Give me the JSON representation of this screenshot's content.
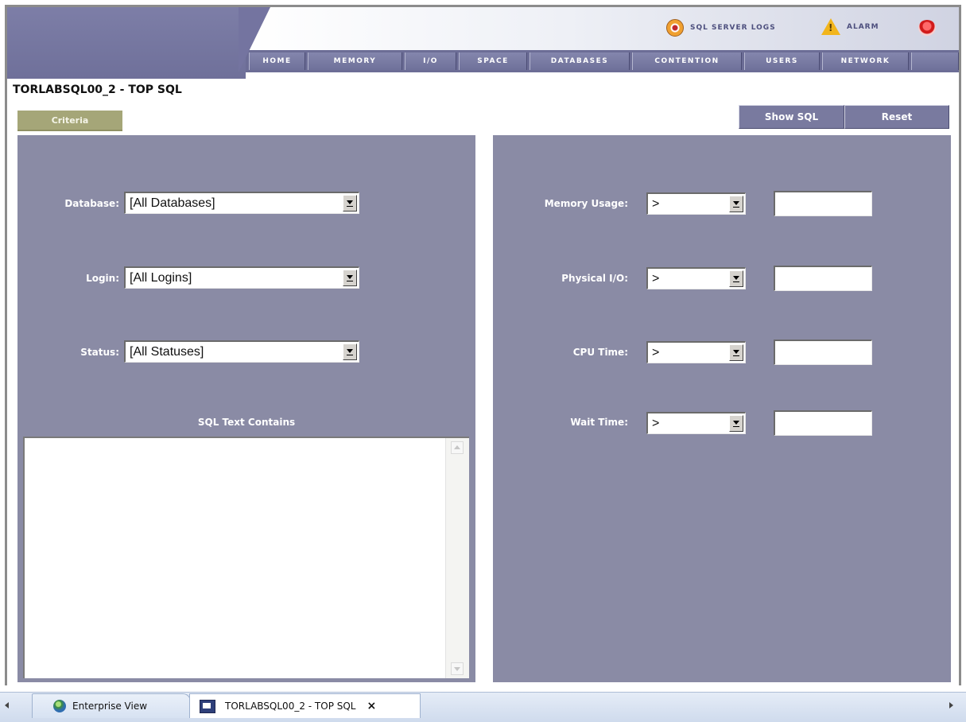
{
  "header": {
    "utilities": [
      {
        "label": "SQL SERVER LOGS",
        "icon": "sql-server-logs-icon"
      },
      {
        "label": "ALARM",
        "icon": "alarm-warning-icon"
      }
    ],
    "power_icon": "power-icon",
    "nav_tabs": [
      "HOME",
      "MEMORY",
      "I/O",
      "SPACE",
      "DATABASES",
      "CONTENTION",
      "USERS",
      "NETWORK"
    ]
  },
  "page": {
    "title": "TORLABSQL00_2 - TOP SQL",
    "criteria_tab": "Criteria",
    "show_sql_button": "Show SQL",
    "reset_button": "Reset"
  },
  "left_panel": {
    "database": {
      "label": "Database:",
      "value": "[All Databases]"
    },
    "login": {
      "label": "Login:",
      "value": "[All Logins]"
    },
    "status": {
      "label": "Status:",
      "value": "[All Statuses]"
    },
    "sql_text_label": "SQL Text Contains",
    "sql_text_value": ""
  },
  "right_panel": {
    "filters": [
      {
        "label": "Memory Usage:",
        "operator": ">",
        "value": ""
      },
      {
        "label": "Physical I/O:",
        "operator": ">",
        "value": ""
      },
      {
        "label": "CPU Time:",
        "operator": ">",
        "value": ""
      },
      {
        "label": "Wait Time:",
        "operator": ">",
        "value": ""
      }
    ]
  },
  "tabs": {
    "enterprise_view": "Enterprise View",
    "active_tab": "TORLABSQL00_2 - TOP SQL",
    "close": "×"
  },
  "colors": {
    "panel": "#8a8ba5",
    "nav": "#6c6d96",
    "criteria": "#a5a678",
    "button": "#797a9f"
  }
}
